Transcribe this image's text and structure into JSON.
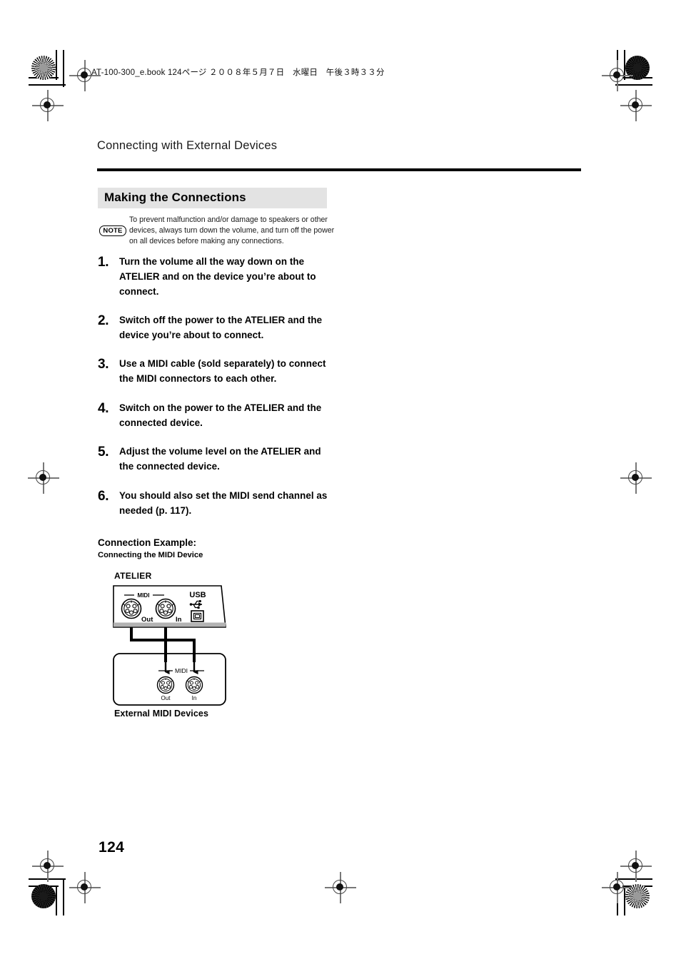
{
  "page": {
    "slug_line": "AT-100-300_e.book  124ページ  ２００８年５月７日　水曜日　午後３時３３分",
    "running_head": "Connecting with External Devices",
    "page_number": "124"
  },
  "section": {
    "banner_title": "Making the Connections"
  },
  "note": {
    "label": "NOTE",
    "text": "To prevent malfunction and/or damage to speakers or other devices, always turn down the volume, and turn off the power on all devices before making any connections."
  },
  "steps": [
    {
      "number": "1.",
      "text": "Turn the volume all the way down on the ATELIER and on the device you’re about to connect."
    },
    {
      "number": "2.",
      "text": "Switch off the power to the ATELIER and the device you’re about to connect."
    },
    {
      "number": "3.",
      "text": "Use a MIDI cable (sold separately) to connect the MIDI connectors to each other."
    },
    {
      "number": "4.",
      "text": "Switch on the power to the ATELIER and the connected device."
    },
    {
      "number": "5.",
      "text": "Adjust the volume level on the ATELIER and the connected device."
    },
    {
      "number": "6.",
      "text": "You should also set the MIDI send channel as needed (p. 117)."
    }
  ],
  "example": {
    "title": "Connection Example:",
    "subtitle": "Connecting the MIDI Device"
  },
  "diagram": {
    "atelier_label": "ATELIER",
    "external_label": "External MIDI Devices",
    "atelier_midi_group": "MIDI",
    "atelier_out": "Out",
    "atelier_in": "In",
    "usb_label": "USB",
    "external_midi_group": "MIDI",
    "external_out": "Out",
    "external_in": "In"
  },
  "colors": {
    "banner_gray": "#e3e3e3",
    "panel_gray": "#b3b3b3",
    "rule_black": "#000000",
    "text_black": "#000000"
  }
}
